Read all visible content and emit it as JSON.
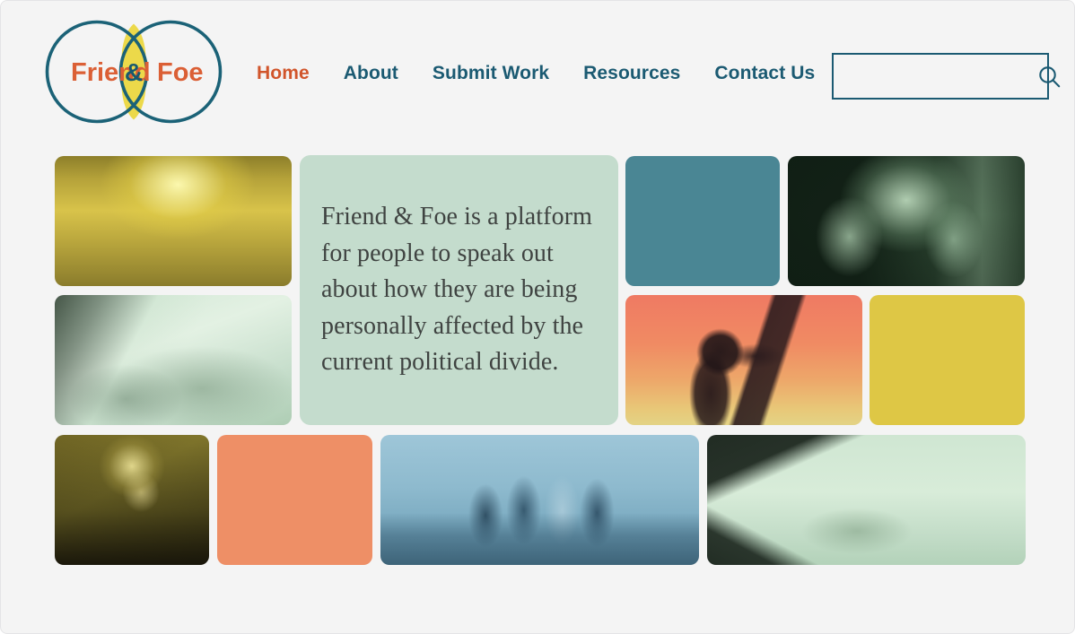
{
  "page": {
    "background_color": "#f4f4f4"
  },
  "header": {
    "logo": {
      "name": "friend-and-foe-venn-logo",
      "left_word": "Friend",
      "center_word": "&",
      "right_word": "Foe",
      "word_color": "#db5f35",
      "ampersand_color": "#18596f",
      "circle_stroke_color": "#1b6277",
      "lens_fill_color": "#ecd94a"
    },
    "nav": {
      "items": [
        {
          "label": "Home",
          "active": true
        },
        {
          "label": "About",
          "active": false
        },
        {
          "label": "Submit Work",
          "active": false
        },
        {
          "label": "Resources",
          "active": false
        },
        {
          "label": "Contact Us",
          "active": false
        }
      ],
      "active_color": "#d1552b",
      "inactive_color": "#1b5a72"
    },
    "search": {
      "value": "",
      "placeholder": "",
      "icon": "search-icon",
      "border_color": "#1b5a72"
    }
  },
  "main": {
    "intro": {
      "text": "Friend & Foe is a platform for people to speak out about how they are being personally affected by the current political divide.",
      "background_color": "#c4dccd",
      "text_color": "#3f4341"
    },
    "tiles": [
      {
        "name": "photo-beach-sunset-two-people",
        "kind": "photo",
        "tone": "yellow",
        "alt": "Two people standing apart on a beach at sunset"
      },
      {
        "name": "photo-clasped-hands",
        "kind": "photo",
        "tone": "mint",
        "alt": "Close-up of arms and hands clasped together"
      },
      {
        "name": "color-block-teal",
        "kind": "color",
        "color": "#4a8694"
      },
      {
        "name": "photo-stressed-man",
        "kind": "photo",
        "tone": "dark-green",
        "alt": "Man holding his head in his hands"
      },
      {
        "name": "photo-woman-with-megaphone",
        "kind": "photo",
        "tone": "coral-gradient",
        "alt": "Silhouette of a woman speaking into a megaphone"
      },
      {
        "name": "color-block-yellow",
        "kind": "color",
        "color": "#dec745"
      },
      {
        "name": "photo-laughing-woman",
        "kind": "photo",
        "tone": "olive",
        "alt": "Woman laughing with her head tilted back"
      },
      {
        "name": "color-block-coral",
        "kind": "color",
        "color": "#ee8f66"
      },
      {
        "name": "photo-four-friends-embracing",
        "kind": "photo",
        "tone": "blue",
        "alt": "Four friends seen from behind with arms around each other in a field"
      },
      {
        "name": "photo-handshake",
        "kind": "photo",
        "tone": "mint",
        "alt": "Two people reaching out to shake hands"
      }
    ]
  }
}
